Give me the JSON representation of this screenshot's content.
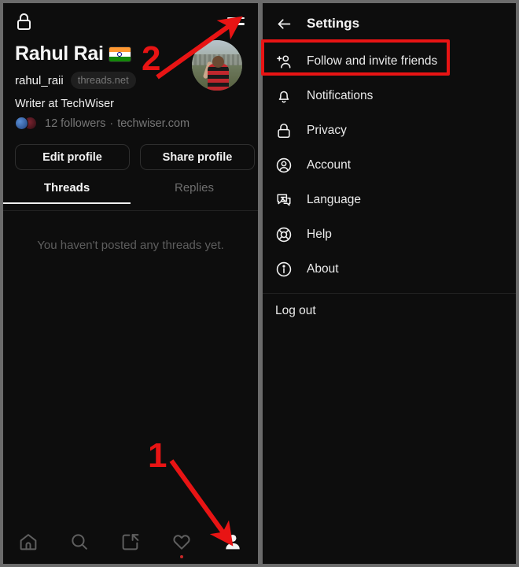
{
  "app": {
    "name": "Threads",
    "theme_background": "#0d0d0d",
    "accent_red": "#e81414"
  },
  "left_panel": {
    "lock_icon": "lock-icon",
    "menu_icon": "hamburger-menu-icon",
    "profile": {
      "display_name": "Rahul Rai",
      "flag_emoji": "india-flag",
      "handle": "rahul_raii",
      "handle_badge": "threads.net",
      "bio": "Writer at TechWiser",
      "followers": "12 followers",
      "separator": "·",
      "link": "techwiser.com",
      "avatar": "profile-photo"
    },
    "buttons": {
      "edit_profile": "Edit profile",
      "share_profile": "Share profile"
    },
    "tabs": [
      {
        "label": "Threads",
        "active": true
      },
      {
        "label": "Replies",
        "active": false
      }
    ],
    "empty_state": "You haven't posted any threads yet.",
    "bottom_nav": [
      {
        "name": "home-icon",
        "label": "Home",
        "active": false,
        "badge": false
      },
      {
        "name": "search-icon",
        "label": "Search",
        "active": false,
        "badge": false
      },
      {
        "name": "compose-icon",
        "label": "Compose",
        "active": false,
        "badge": false
      },
      {
        "name": "heart-icon",
        "label": "Activity",
        "active": false,
        "badge": true
      },
      {
        "name": "profile-icon",
        "label": "Profile",
        "active": true,
        "badge": false
      }
    ]
  },
  "right_panel": {
    "back_icon": "back-arrow-icon",
    "title": "Settings",
    "items": [
      {
        "icon": "person-add-icon",
        "label": "Follow and invite friends",
        "highlighted": true
      },
      {
        "icon": "bell-icon",
        "label": "Notifications",
        "highlighted": false
      },
      {
        "icon": "lock-icon",
        "label": "Privacy",
        "highlighted": false
      },
      {
        "icon": "account-icon",
        "label": "Account",
        "highlighted": false
      },
      {
        "icon": "language-icon",
        "label": "Language",
        "highlighted": false
      },
      {
        "icon": "help-icon",
        "label": "Help",
        "highlighted": false
      },
      {
        "icon": "info-icon",
        "label": "About",
        "highlighted": false
      }
    ],
    "logout": "Log out"
  },
  "annotations": {
    "step1": "1",
    "step2": "2",
    "highlight_color": "#e81414",
    "step1_target": "profile-tab-bottom-nav",
    "step2_target": "hamburger-menu-icon"
  }
}
